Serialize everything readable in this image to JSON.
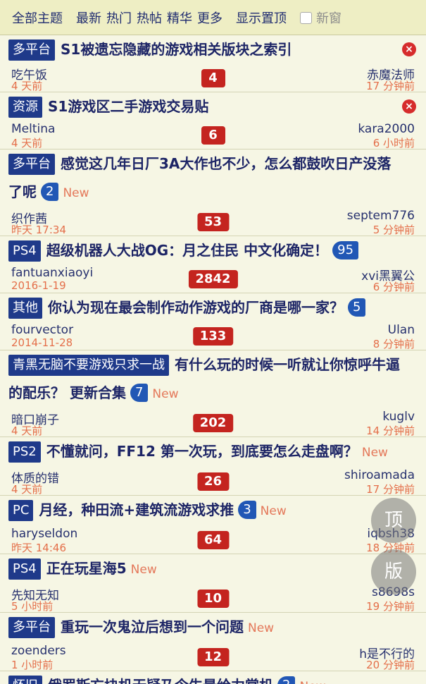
{
  "topbar": {
    "items": [
      "全部主题",
      "最新",
      "热门",
      "热帖",
      "精华",
      "更多",
      "显示置顶"
    ],
    "newwin_label": "新窗"
  },
  "threads": [
    {
      "tag": "多平台",
      "title": "S1被遗忘隐藏的游戏相关版块之索引",
      "pages": "",
      "is_new": false,
      "closable": true,
      "author": "吃午饭",
      "posted": "4 天前",
      "replies": "4",
      "last_user": "赤魔法师",
      "last_time": "17 分钟前"
    },
    {
      "tag": "资源",
      "title": "S1游戏区二手游戏交易贴",
      "pages": "",
      "is_new": false,
      "closable": true,
      "author": "Meltina",
      "posted": "4 天前",
      "replies": "6",
      "last_user": "kara2000",
      "last_time": "6 小时前"
    },
    {
      "tag": "多平台",
      "title": "感觉这几年日厂3A大作也不少，怎么都鼓吹日产没落了呢",
      "pages": "2",
      "is_new": true,
      "closable": false,
      "author": "织作茜",
      "posted": "昨天 17:34",
      "replies": "53",
      "last_user": "septem776",
      "last_time": "5 分钟前"
    },
    {
      "tag": "PS4",
      "title": "超级机器人大战OG：月之住民 中文化确定！",
      "pages": "95",
      "is_new": false,
      "closable": false,
      "author": "fantuanxiaoyi",
      "posted": "2016-1-19",
      "replies": "2842",
      "last_user": "xvi黑翼公",
      "last_time": "6 分钟前"
    },
    {
      "tag": "其他",
      "title": "你认为现在最会制作动作游戏的厂商是哪一家？",
      "pages": "5",
      "is_new": false,
      "closable": false,
      "author": "fourvector",
      "posted": "2014-11-28",
      "replies": "133",
      "last_user": "Ulan",
      "last_time": "8 分钟前"
    },
    {
      "tag": "青黑无脑不要游戏只求一战",
      "title": "有什么玩的时候一听就让你惊呼牛逼的配乐？ 更新合集",
      "pages": "7",
      "is_new": true,
      "closable": false,
      "author": "暗口崩子",
      "posted": "4 天前",
      "replies": "202",
      "last_user": "kuglv",
      "last_time": "14 分钟前"
    },
    {
      "tag": "PS2",
      "title": "不懂就问，FF12 第一次玩，到底要怎么走盘啊？",
      "pages": "",
      "is_new": true,
      "closable": false,
      "author": "体质的错",
      "posted": "4 天前",
      "replies": "26",
      "last_user": "shiroamada",
      "last_time": "17 分钟前"
    },
    {
      "tag": "PC",
      "title": "月经，种田流+建筑流游戏求推",
      "pages": "3",
      "is_new": true,
      "closable": false,
      "author": "haryseldon",
      "posted": "昨天 14:46",
      "replies": "64",
      "last_user": "iqbsh38",
      "last_time": "18 分钟前"
    },
    {
      "tag": "PS4",
      "title": "正在玩星海5",
      "pages": "",
      "is_new": true,
      "closable": false,
      "author": "先知无知",
      "posted": "5 小时前",
      "replies": "10",
      "last_user": "s8698s",
      "last_time": "19 分钟前"
    },
    {
      "tag": "多平台",
      "title": "重玩一次鬼泣后想到一个问题",
      "pages": "",
      "is_new": true,
      "closable": false,
      "author": "zoenders",
      "posted": "1 小时前",
      "replies": "12",
      "last_user": "h是不行的",
      "last_time": "20 分钟前"
    },
    {
      "tag": "怀旧",
      "title": "俄罗斯方块机无疑乃今生最给力掌机",
      "pages": "2",
      "is_new": true,
      "closable": false,
      "author": "",
      "posted": "",
      "replies": "",
      "last_user": "",
      "last_time": ""
    }
  ],
  "new_label": "New",
  "close_glyph": "×",
  "float": {
    "top_label": "顶",
    "page_label": "版"
  }
}
